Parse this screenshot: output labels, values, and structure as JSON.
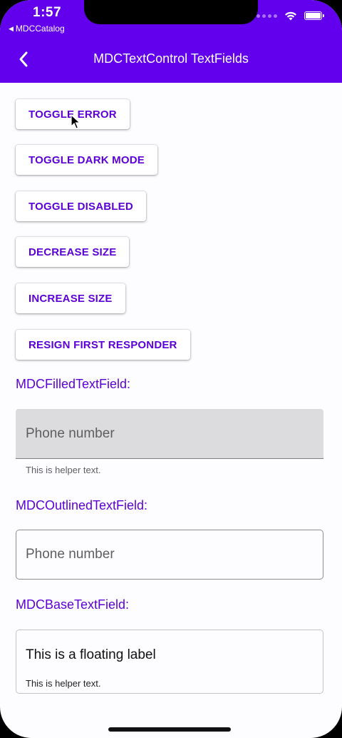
{
  "status_bar": {
    "time": "1:57",
    "back_app_label": "MDCCatalog",
    "wifi_icon": "wifi-icon",
    "battery_icon": "battery-icon"
  },
  "app_bar": {
    "title": "MDCTextControl TextFields",
    "back_icon": "chevron-left-icon",
    "background_color": "#6200ee"
  },
  "buttons": [
    {
      "label": "TOGGLE ERROR"
    },
    {
      "label": "TOGGLE DARK MODE"
    },
    {
      "label": "TOGGLE DISABLED"
    },
    {
      "label": "DECREASE SIZE"
    },
    {
      "label": "INCREASE SIZE"
    },
    {
      "label": "RESIGN FIRST RESPONDER"
    }
  ],
  "filled_section": {
    "label": "MDCFilledTextField:",
    "placeholder": "Phone number",
    "helper": "This is helper text."
  },
  "outlined_section": {
    "label": "MDCOutlinedTextField:",
    "placeholder": "Phone number"
  },
  "base_section": {
    "label": "MDCBaseTextField:",
    "floating_label": "This is a floating label",
    "helper": "This is helper text."
  },
  "colors": {
    "primary": "#6200ee",
    "button_text": "#5b00d6"
  }
}
